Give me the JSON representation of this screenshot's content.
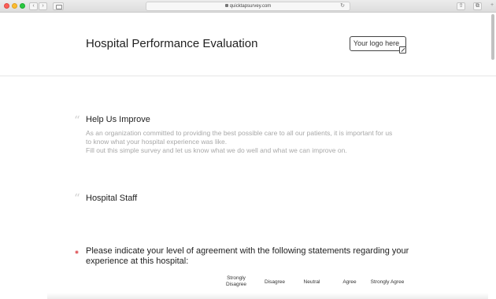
{
  "browser": {
    "url": "quicktapsurvey.com",
    "back_glyph": "‹",
    "forward_glyph": "›",
    "reload_glyph": "↻",
    "share_glyph": "⇧",
    "tabs_glyph": "⧉",
    "plus_glyph": "+",
    "colors": {
      "close": "#fc5f57",
      "minimize": "#fdbc2e",
      "maximize": "#28c840"
    }
  },
  "header": {
    "title": "Hospital Performance Evaluation",
    "logo_label": "Your logo here"
  },
  "sections": {
    "help": {
      "quote_glyph": "“",
      "heading": "Help Us Improve",
      "line1": "As an organization committed to providing the best possible care to all our patients, it is important for us",
      "line2": "to know what your hospital experience was like.",
      "line3": "Fill out this simple survey and let us know what we do well and what we can improve on."
    },
    "staff": {
      "quote_glyph": "“",
      "heading": "Hospital Staff"
    }
  },
  "question": {
    "text": "Please indicate your level of agreement with the following statements regarding your experience at this hospital:",
    "required_color": "#e0595e",
    "scale": [
      "Strongly Disagree",
      "Disagree",
      "Neutral",
      "Agree",
      "Strongly Agree"
    ]
  }
}
